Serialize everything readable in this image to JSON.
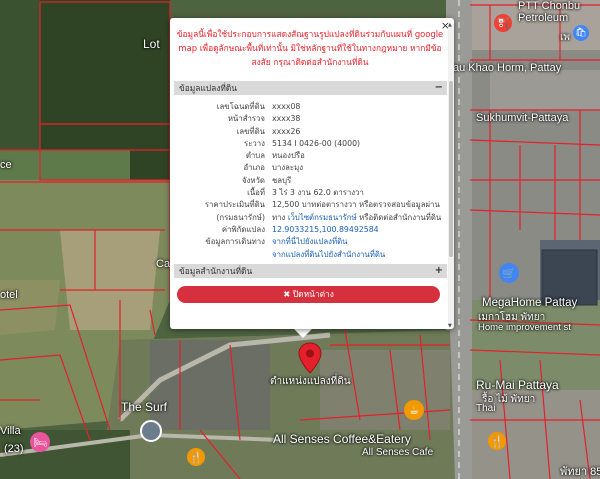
{
  "map": {
    "labels": {
      "lotus": "Lot",
      "ptt": "PTT Chonbu",
      "petroleum": "Petroleum",
      "pattaya_th": "เพ",
      "khao_horm": "au Khao Horm, Pattay",
      "sukhumvit": "Sukhumvit-Pattaya",
      "ce": "ce",
      "ca": "Ca",
      "otel": "otel",
      "megahome": "MegaHome Pattay",
      "megahome_th": "เมกาโฮม พัทยา",
      "home_improvement": "Home improvement st",
      "marker_label": "ตำแหน่งแปลงที่ดิน",
      "rumai": "Ru-Mai Pattaya",
      "rumai_th": "รื้อ ไม้ พัทยา",
      "thai": "Thai",
      "the_surf": "The Surf",
      "villa": "Villa",
      "villa_num": "(23)",
      "all_senses": "All Senses Coffee&Eatery",
      "all_senses_sub": "All Senses Cafe",
      "pattaya_85": "พัทยา 85"
    }
  },
  "popup": {
    "close_symbol": "×",
    "notice": "ข้อมูลนี้เพื่อใช้ประกอบการแสดงสัณฐานรูปแปลงที่ดินร่วมกับแผนที่ google map เพื่อดูลักษณะพื้นที่เท่านั้น มิใช่หลักฐานที่ใช้ในทางกฎหมาย หากมีข้อสงสัย กรุณาติดต่อสำนักงานที่ดิน",
    "section1": "ข้อมูลแปลงที่ดิน",
    "section1_toggle": "−",
    "rows": [
      {
        "key": "เลขโฉนดที่ดิน",
        "value": "xxxx08"
      },
      {
        "key": "หน้าสำรวจ",
        "value": "xxxx38"
      },
      {
        "key": "เลขที่ดิน",
        "value": "xxxx26"
      },
      {
        "key": "ระวาง",
        "value": "5134 I 0426-00 (4000)"
      },
      {
        "key": "ตำบล",
        "value": "หนองปรือ"
      },
      {
        "key": "อำเภอ",
        "value": "บางละมุง"
      },
      {
        "key": "จังหวัด",
        "value": "ชลบุรี"
      },
      {
        "key": "เนื้อที่",
        "value": "3 ไร่ 3 งาน 62.0 ตารางวา"
      },
      {
        "key": "ราคาประเมินที่ดิน",
        "value": "12,500 บาทต่อตารางวา หรือตรวจสอบข้อมูลผ่าน"
      },
      {
        "key": "(กรมธนารักษ์)",
        "value_pre": "ทาง ",
        "value_link": "เว็บไซต์กรมธนารักษ์",
        "value_post": " หรือติดต่อสำนักงานที่ดิน"
      },
      {
        "key": "ค่าพิกัดแปลง",
        "value": "12.9033215,100.89492584",
        "link": true
      },
      {
        "key": "ข้อมูลการเดินทาง",
        "value": "จากที่นี่ไปยังแปลงที่ดิน",
        "link": true
      },
      {
        "key": "",
        "value": "จากแปลงที่ดินไปยังสำนักงานที่ดิน",
        "link": true
      }
    ],
    "section2": "ข้อมูลสำนักงานที่ดิน",
    "section2_toggle": "+",
    "close_button": "✖ ปิดหน้าต่าง",
    "scroll_up": "▲",
    "scroll_down": "▼"
  }
}
